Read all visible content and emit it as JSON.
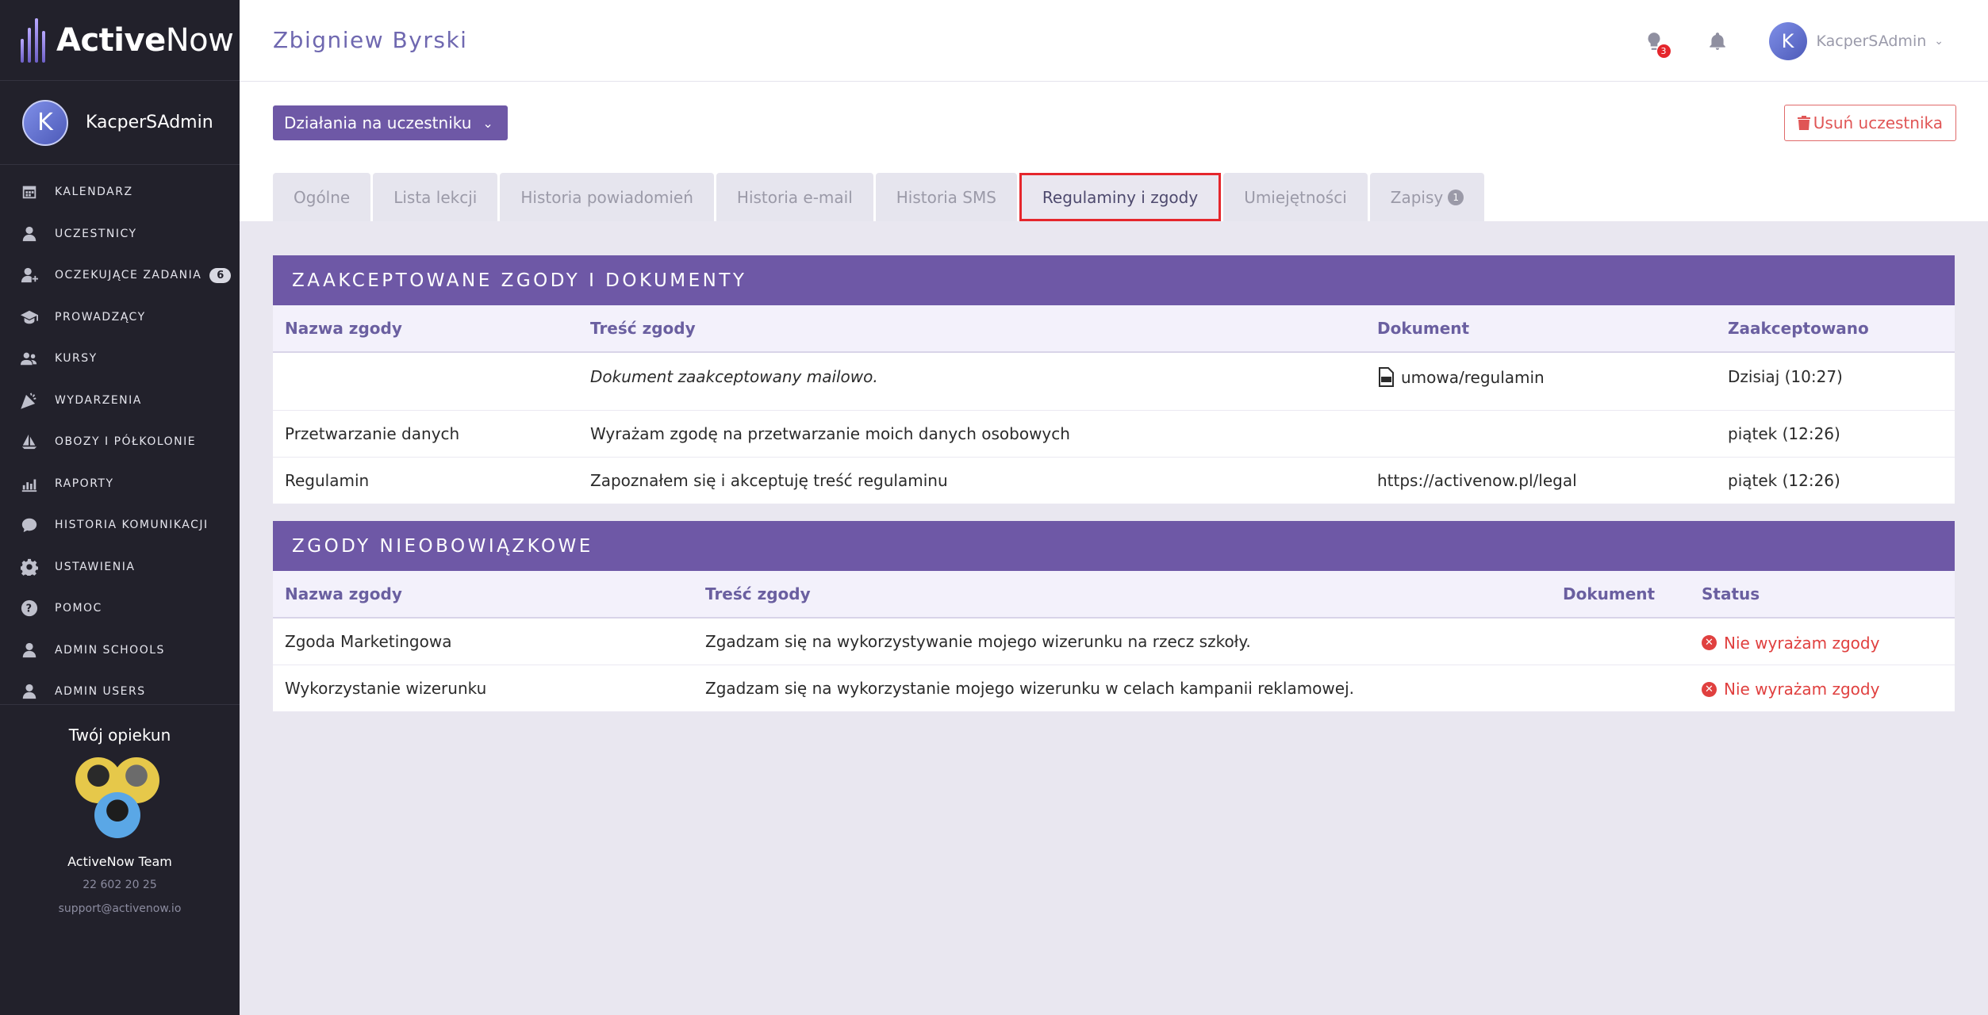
{
  "brand": {
    "name_bold": "Active",
    "name_light": "Now"
  },
  "sidebar": {
    "user_initial": "K",
    "user_name": "KacperSAdmin",
    "items": [
      {
        "label": "Kalendarz",
        "icon": "calendar-icon"
      },
      {
        "label": "Uczestnicy",
        "icon": "user-icon"
      },
      {
        "label": "Oczekujące zadania",
        "icon": "user-check-icon",
        "badge": "6"
      },
      {
        "label": "Prowadzący",
        "icon": "graduation-cap-icon"
      },
      {
        "label": "Kursy",
        "icon": "users-group-icon"
      },
      {
        "label": "Wydarzenia",
        "icon": "party-icon"
      },
      {
        "label": "Obozy i półkolonie",
        "icon": "sailboat-icon"
      },
      {
        "label": "Raporty",
        "icon": "bar-chart-icon"
      },
      {
        "label": "Historia komunikacji",
        "icon": "chat-icon"
      },
      {
        "label": "Ustawienia",
        "icon": "gear-icon"
      },
      {
        "label": "Pomoc",
        "icon": "help-icon"
      },
      {
        "label": "Admin Schools",
        "icon": "user-icon"
      },
      {
        "label": "Admin Users",
        "icon": "user-icon"
      }
    ],
    "caretaker": {
      "title": "Twój opiekun",
      "team": "ActiveNow Team",
      "phone": "22 602 20 25",
      "email": "support@activenow.io"
    }
  },
  "topbar": {
    "title": "Zbigniew Byrski",
    "notif_count": "3",
    "user_initial": "K",
    "user_name": "KacperSAdmin"
  },
  "actions": {
    "actions_label": "Działania na uczestniku",
    "delete_label": "Usuń uczestnika"
  },
  "tabs": [
    {
      "label": "Ogólne"
    },
    {
      "label": "Lista lekcji"
    },
    {
      "label": "Historia powiadomień"
    },
    {
      "label": "Historia e-mail"
    },
    {
      "label": "Historia SMS"
    },
    {
      "label": "Regulaminy i zgody",
      "active": true
    },
    {
      "label": "Umiejętności"
    },
    {
      "label": "Zapisy",
      "badge": "1"
    }
  ],
  "accepted": {
    "heading": "Zaakceptowane zgody i dokumenty",
    "columns": [
      "Nazwa zgody",
      "Treść zgody",
      "Dokument",
      "Zaakceptowano"
    ],
    "rows": [
      {
        "name": "",
        "content": "Dokument zaakceptowany mailowo.",
        "document": "umowa/regulamin",
        "accepted": "Dzisiaj (10:27)"
      },
      {
        "name": "Przetwarzanie danych",
        "content": "Wyrażam zgodę na przetwarzanie moich danych osobowych",
        "document": "",
        "accepted": "piątek (12:26)"
      },
      {
        "name": "Regulamin",
        "content": "Zapoznałem się i akceptuję treść regulaminu",
        "document": "https://activenow.pl/legal",
        "accepted": "piątek (12:26)"
      }
    ]
  },
  "optional": {
    "heading": "Zgody nieobowiązkowe",
    "columns": [
      "Nazwa zgody",
      "Treść zgody",
      "Dokument",
      "Status"
    ],
    "rows": [
      {
        "name": "Zgoda Marketingowa",
        "content": "Zgadzam się na wykorzystywanie mojego wizerunku na rzecz szkoły.",
        "document": "",
        "status": "Nie wyrażam zgody"
      },
      {
        "name": "Wykorzystanie wizerunku",
        "content": "Zgadzam się na wykorzystanie mojego wizerunku w celach kampanii reklamowej.",
        "document": "",
        "status": "Nie wyrażam zgody"
      }
    ]
  },
  "colors": {
    "accent": "#6e58a6",
    "sidebar": "#22212b",
    "danger": "#e0403f",
    "highlight": "#e5262c"
  }
}
